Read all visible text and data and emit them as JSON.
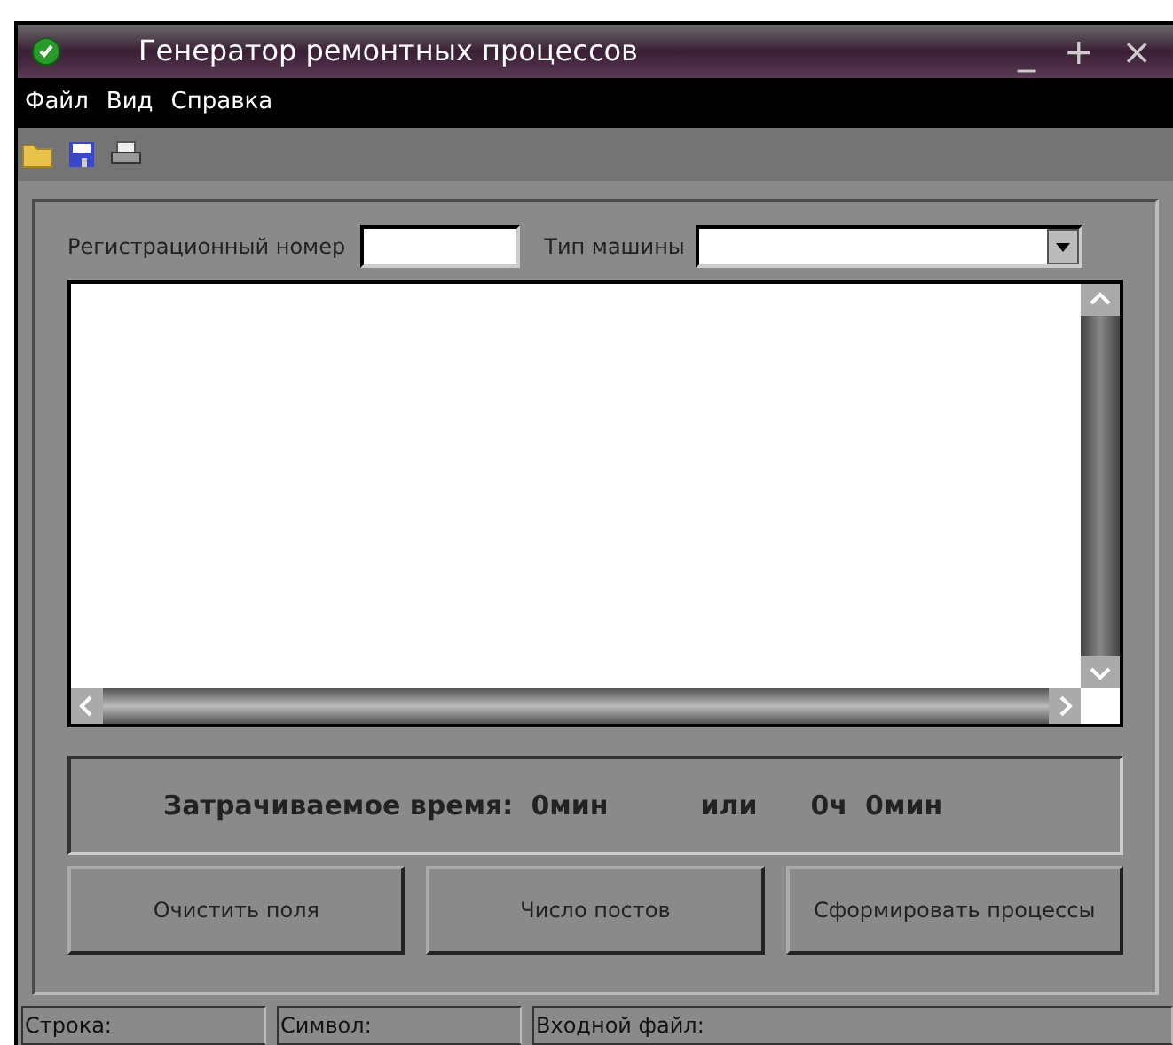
{
  "window": {
    "title": "Генератор ремонтных процессов",
    "controls": [
      "_",
      "+",
      "×"
    ]
  },
  "menu": [
    "Файл",
    "Вид",
    "Справка"
  ],
  "form": {
    "reg_label": "Регистрационный номер",
    "type_label": "Тип машины"
  },
  "time": {
    "label": "Затрачиваемое время:",
    "minutes": "0мин",
    "or": "или",
    "hours": "0ч",
    "minutes2": "0мин"
  },
  "buttons": [
    "Очистить поля",
    "Число постов",
    "Сформировать процессы"
  ],
  "status_bar": [
    "Строка:",
    "Символ:",
    "Входной файл:"
  ]
}
